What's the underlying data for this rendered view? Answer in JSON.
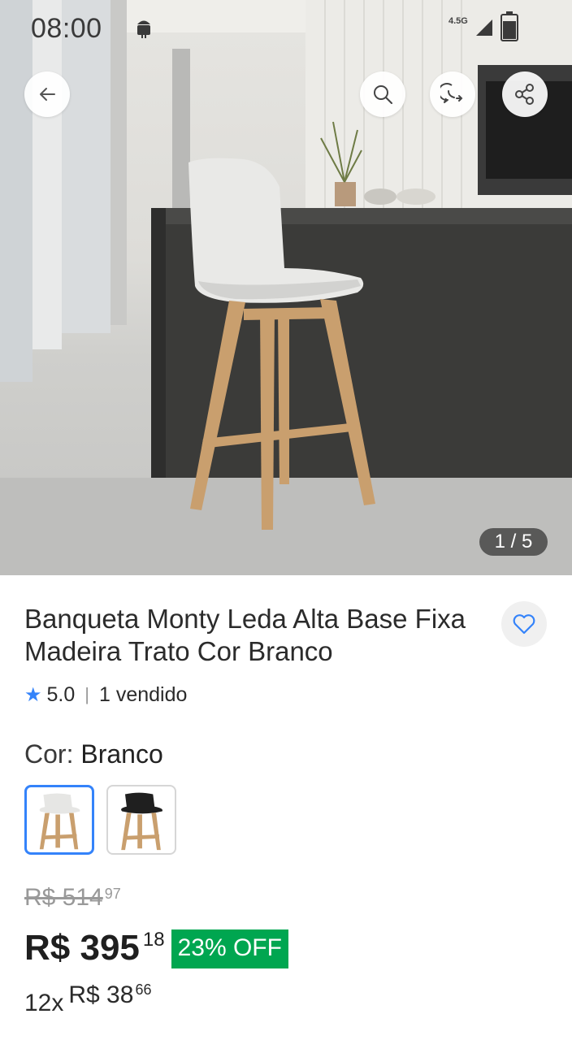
{
  "status_bar": {
    "time": "08:00",
    "network": "4.5G",
    "icons": [
      "android-icon",
      "signal-icon",
      "battery-icon"
    ]
  },
  "toolbar": {
    "icons": [
      "back-arrow-icon",
      "search-icon",
      "whatsapp-icon",
      "share-icon"
    ]
  },
  "gallery": {
    "counter": "1 / 5"
  },
  "product": {
    "title": "Banqueta Monty Leda Alta Base Fixa Madeira Trato Cor Branco",
    "rating": "5.0",
    "sold": "1 vendido",
    "color_label": "Cor:",
    "color_value": "Branco",
    "variants": [
      "white-stool",
      "black-stool"
    ]
  },
  "pricing": {
    "old_price": "R$ 514",
    "old_cents": "97",
    "price": "R$ 395",
    "price_cents": "18",
    "discount": "23% OFF",
    "installments_count": "12x",
    "installment_price": "R$ 38",
    "installment_cents": "66"
  },
  "colors": {
    "accent": "#3483fa",
    "discount_badge": "#00a650"
  }
}
